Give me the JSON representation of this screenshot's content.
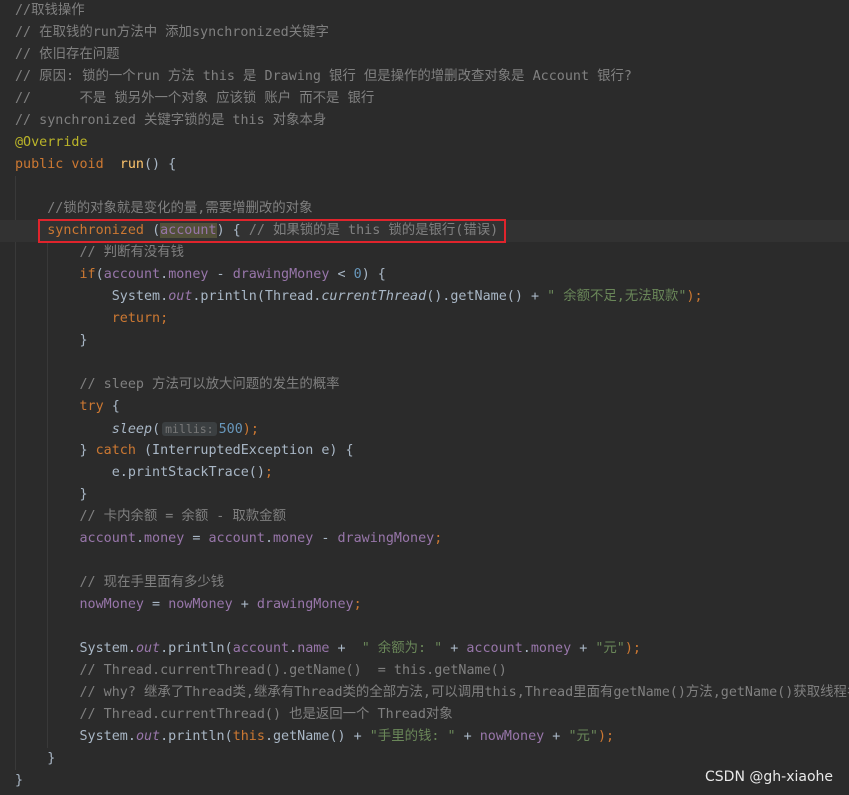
{
  "lines": [
    [
      [
        "//取钱操作",
        "c"
      ]
    ],
    [
      [
        "// 在取钱的run方法中 添加synchronized关键字",
        "c"
      ]
    ],
    [
      [
        "// 依旧存在问题",
        "c"
      ]
    ],
    [
      [
        "// 原因: 锁的一个run 方法 this 是 Drawing 银行 但是操作的增删改查对象是 Account 银行?",
        "c"
      ]
    ],
    [
      [
        "//      不是 锁另外一个对象 应该锁 账户 而不是 银行",
        "c"
      ]
    ],
    [
      [
        "// synchronized 关键字锁的是 this 对象本身",
        "c"
      ]
    ],
    [
      [
        "@Override",
        "a"
      ]
    ],
    [
      [
        "public void  ",
        "k"
      ],
      [
        "run",
        "m"
      ],
      [
        "() {",
        "t"
      ]
    ],
    [],
    [
      [
        "    ",
        "t"
      ],
      [
        "//锁的对象就是变化的量,需要增删改的对象",
        "c"
      ]
    ],
    [
      [
        "    ",
        "t"
      ],
      [
        "synchronized ",
        "k"
      ],
      [
        "(",
        "t"
      ],
      [
        "account",
        "hl"
      ],
      [
        ") { ",
        "t"
      ],
      [
        "// 如果锁的是 this 锁的是银行(错误)",
        "c"
      ]
    ],
    [
      [
        "        ",
        "t"
      ],
      [
        "// 判断有没有钱",
        "c"
      ]
    ],
    [
      [
        "        ",
        "t"
      ],
      [
        "if",
        "k"
      ],
      [
        "(",
        "t"
      ],
      [
        "account",
        "f"
      ],
      [
        ".",
        "t"
      ],
      [
        "money",
        "f"
      ],
      [
        " - ",
        "t"
      ],
      [
        "drawingMoney",
        "f"
      ],
      [
        " < ",
        "t"
      ],
      [
        "0",
        "n"
      ],
      [
        ") {",
        "t"
      ]
    ],
    [
      [
        "            System.",
        "t"
      ],
      [
        "out",
        "fi"
      ],
      [
        ".println(Thread.",
        "t"
      ],
      [
        "currentThread",
        "si"
      ],
      [
        "().getName() + ",
        "t"
      ],
      [
        "\" 余额不足,无法取款\"",
        "s"
      ],
      [
        ");",
        "k"
      ]
    ],
    [
      [
        "            ",
        "t"
      ],
      [
        "return;",
        "k"
      ]
    ],
    [
      [
        "        }",
        "t"
      ]
    ],
    [],
    [
      [
        "        ",
        "t"
      ],
      [
        "// sleep 方法可以放大问题的发生的概率",
        "c"
      ]
    ],
    [
      [
        "        ",
        "t"
      ],
      [
        "try",
        "k"
      ],
      [
        " {",
        "t"
      ]
    ],
    [
      [
        "            ",
        "t"
      ],
      [
        "sleep",
        "si"
      ],
      [
        "(",
        "t"
      ],
      [
        "millis:",
        "h"
      ],
      [
        "500",
        "n"
      ],
      [
        ");",
        "k"
      ]
    ],
    [
      [
        "        } ",
        "t"
      ],
      [
        "catch ",
        "k"
      ],
      [
        "(InterruptedException e) {",
        "t"
      ]
    ],
    [
      [
        "            e.printStackTrace()",
        "t"
      ],
      [
        ";",
        "k"
      ]
    ],
    [
      [
        "        }",
        "t"
      ]
    ],
    [
      [
        "        ",
        "t"
      ],
      [
        "// 卡内余额 = 余额 - 取款金额",
        "c"
      ]
    ],
    [
      [
        "        ",
        "t"
      ],
      [
        "account",
        "f"
      ],
      [
        ".",
        "t"
      ],
      [
        "money",
        "f"
      ],
      [
        " = ",
        "t"
      ],
      [
        "account",
        "f"
      ],
      [
        ".",
        "t"
      ],
      [
        "money",
        "f"
      ],
      [
        " - ",
        "t"
      ],
      [
        "drawingMoney",
        "f"
      ],
      [
        ";",
        "k"
      ]
    ],
    [],
    [
      [
        "        ",
        "t"
      ],
      [
        "// 现在手里面有多少钱",
        "c"
      ]
    ],
    [
      [
        "        ",
        "t"
      ],
      [
        "nowMoney",
        "f"
      ],
      [
        " = ",
        "t"
      ],
      [
        "nowMoney",
        "f"
      ],
      [
        " + ",
        "t"
      ],
      [
        "drawingMoney",
        "f"
      ],
      [
        ";",
        "k"
      ]
    ],
    [],
    [
      [
        "        System.",
        "t"
      ],
      [
        "out",
        "fi"
      ],
      [
        ".println(",
        "t"
      ],
      [
        "account",
        "f"
      ],
      [
        ".",
        "t"
      ],
      [
        "name",
        "f"
      ],
      [
        " +  ",
        "t"
      ],
      [
        "\" 余额为: \"",
        "s"
      ],
      [
        " + ",
        "t"
      ],
      [
        "account",
        "f"
      ],
      [
        ".",
        "t"
      ],
      [
        "money",
        "f"
      ],
      [
        " + ",
        "t"
      ],
      [
        "\"元\"",
        "s"
      ],
      [
        ");",
        "k"
      ]
    ],
    [
      [
        "        ",
        "t"
      ],
      [
        "// Thread.currentThread().getName()  = this.getName()",
        "c"
      ]
    ],
    [
      [
        "        ",
        "t"
      ],
      [
        "// why? 继承了Thread类,继承有Thread类的全部方法,可以调用this,Thread里面有getName()方法,getName()获取线程名称",
        "c"
      ]
    ],
    [
      [
        "        ",
        "t"
      ],
      [
        "// Thread.currentThread() 也是返回一个 Thread对象",
        "c"
      ]
    ],
    [
      [
        "        System.",
        "t"
      ],
      [
        "out",
        "fi"
      ],
      [
        ".println(",
        "t"
      ],
      [
        "this",
        "k"
      ],
      [
        ".getName() + ",
        "t"
      ],
      [
        "\"手里的钱: \"",
        "s"
      ],
      [
        " + ",
        "t"
      ],
      [
        "nowMoney",
        "f"
      ],
      [
        " + ",
        "t"
      ],
      [
        "\"元\"",
        "s"
      ],
      [
        ");",
        "k"
      ]
    ],
    [
      [
        "    }",
        "t"
      ]
    ],
    [
      [
        "}",
        "t"
      ]
    ]
  ],
  "current_line": 10,
  "watermark": "CSDN @gh-xiaohe"
}
